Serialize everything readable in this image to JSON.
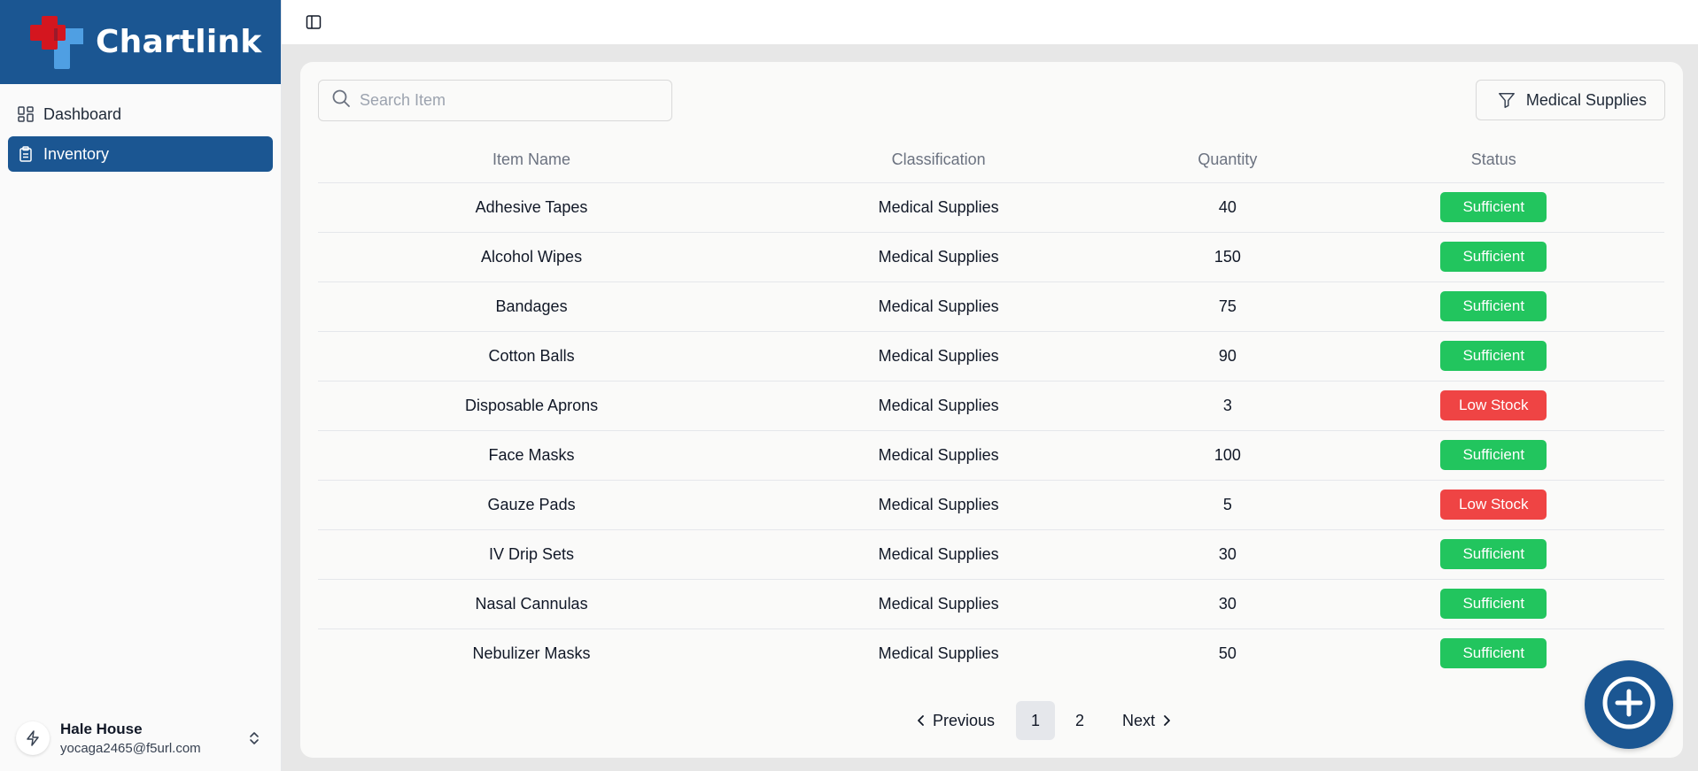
{
  "brand": {
    "name": "Chartlink",
    "colors": {
      "primary": "#1b5692",
      "logo_red": "#d4161f",
      "logo_blue": "#4f9fe3"
    }
  },
  "sidebar": {
    "items": [
      {
        "label": "Dashboard",
        "icon": "dashboard-grid-icon",
        "active": false
      },
      {
        "label": "Inventory",
        "icon": "clipboard-icon",
        "active": true
      }
    ]
  },
  "user": {
    "name": "Hale House",
    "email": "yocaga2465@f5url.com",
    "avatar_icon": "lightning-icon",
    "toggle_icon": "chevrons-up-down-icon"
  },
  "topbar": {
    "toggle_icon": "sidebar-toggle-icon"
  },
  "search": {
    "placeholder": "Search Item",
    "value": ""
  },
  "filter": {
    "label": "Medical Supplies",
    "icon": "filter-funnel-icon"
  },
  "table": {
    "headers": [
      "Item Name",
      "Classification",
      "Quantity",
      "Status"
    ],
    "rows": [
      {
        "name": "Adhesive Tapes",
        "classification": "Medical Supplies",
        "quantity": "40",
        "status": "Sufficient"
      },
      {
        "name": "Alcohol Wipes",
        "classification": "Medical Supplies",
        "quantity": "150",
        "status": "Sufficient"
      },
      {
        "name": "Bandages",
        "classification": "Medical Supplies",
        "quantity": "75",
        "status": "Sufficient"
      },
      {
        "name": "Cotton Balls",
        "classification": "Medical Supplies",
        "quantity": "90",
        "status": "Sufficient"
      },
      {
        "name": "Disposable Aprons",
        "classification": "Medical Supplies",
        "quantity": "3",
        "status": "Low Stock"
      },
      {
        "name": "Face Masks",
        "classification": "Medical Supplies",
        "quantity": "100",
        "status": "Sufficient"
      },
      {
        "name": "Gauze Pads",
        "classification": "Medical Supplies",
        "quantity": "5",
        "status": "Low Stock"
      },
      {
        "name": "IV Drip Sets",
        "classification": "Medical Supplies",
        "quantity": "30",
        "status": "Sufficient"
      },
      {
        "name": "Nasal Cannulas",
        "classification": "Medical Supplies",
        "quantity": "30",
        "status": "Sufficient"
      },
      {
        "name": "Nebulizer Masks",
        "classification": "Medical Supplies",
        "quantity": "50",
        "status": "Sufficient"
      }
    ],
    "status_colors": {
      "Sufficient": "#22c55e",
      "Low Stock": "#ef4444"
    }
  },
  "pagination": {
    "previous_label": "Previous",
    "next_label": "Next",
    "pages": [
      "1",
      "2"
    ],
    "current": "1"
  },
  "fab": {
    "icon": "plus-circle-icon"
  }
}
